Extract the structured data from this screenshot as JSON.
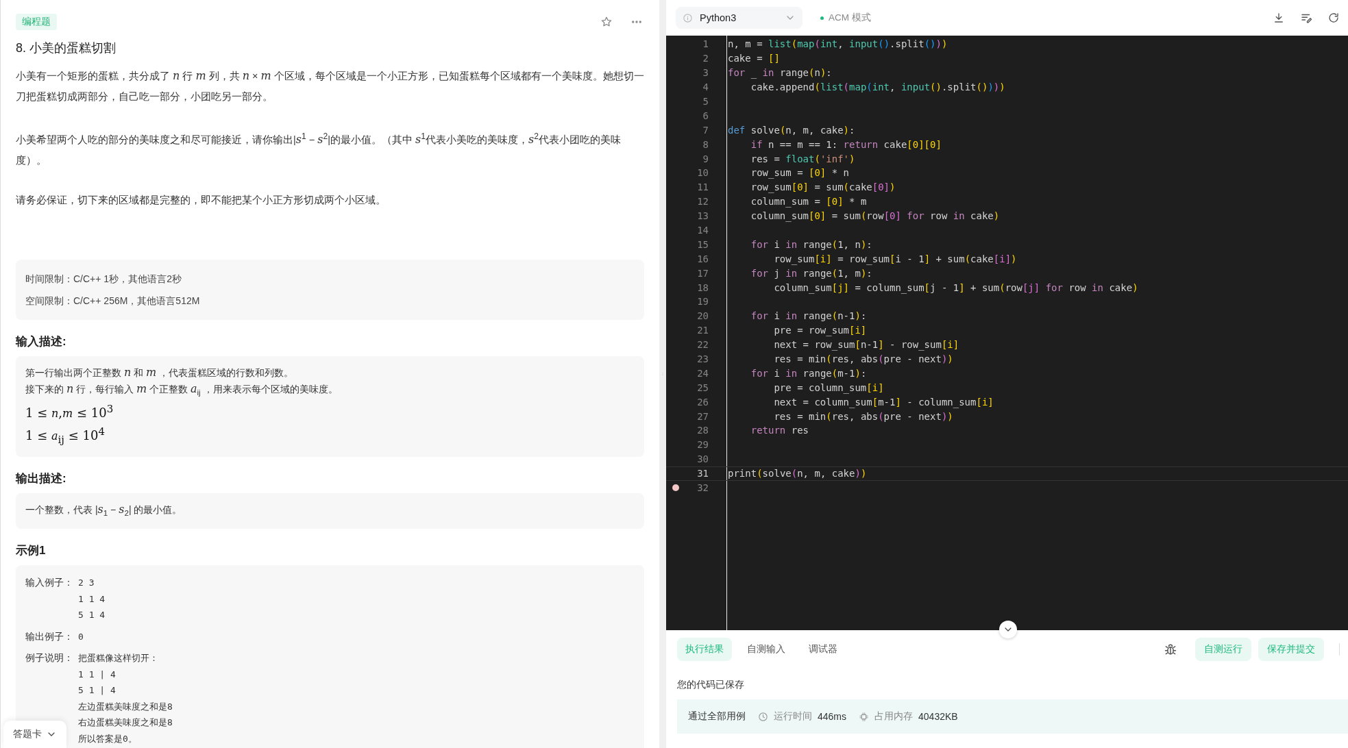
{
  "problem": {
    "tag": "编程题",
    "title": "8. 小美的蛋糕切割",
    "paragraphs": [
      "小美有一个矩形的蛋糕，共分成了 *n* 行 *m* 列，共 *n* × *m* 个区域，每个区域是一个小正方形，已知蛋糕每个区域都有一个美味度。她想切一刀把蛋糕切成两部分，自己吃一部分，小团吃另一部分。",
      "小美希望两个人吃的部分的美味度之和尽可能接近，请你输出|*s*$^{1}$ − *s*$^{2}$|的最小值。（其中 *s*$^{1}$代表小美吃的美味度，*s*$^{2}$代表小团吃的美味度）。",
      "请务必保证，切下来的区域都是完整的，即不能把某个小正方形切成两个小区域。"
    ],
    "limits": [
      "时间限制：C/C++ 1秒，其他语言2秒",
      "空间限制：C/C++ 256M，其他语言512M"
    ],
    "sections": [
      {
        "heading": "输入描述:",
        "lines": [
          {
            "kind": "text",
            "text": "第一行输出两个正整数 *n* 和 *m* ，代表蛋糕区域的行数和列数。"
          },
          {
            "kind": "text",
            "text": "接下来的 *n* 行，每行输入 *m* 个正整数 *a*$_{ij}$ ，用来表示每个区域的美味度。"
          },
          {
            "kind": "formula",
            "text": "1 ≤ *n*,*m* ≤ 10$^{3}$"
          },
          {
            "kind": "formula",
            "text": "1 ≤ *a*$_{ij}$ ≤ 10$^{4}$"
          }
        ]
      },
      {
        "heading": "输出描述:",
        "lines": [
          {
            "kind": "text",
            "text": "一个整数，代表 |*s*$_{1}$ − *s*$_{2}$| 的最小值。"
          }
        ]
      }
    ],
    "example": {
      "heading": "示例1",
      "rows": [
        {
          "label": "输入例子：",
          "lines": [
            "2 3",
            "1 1 4",
            "5 1 4"
          ]
        },
        {
          "label": "输出例子：",
          "lines": [
            "0"
          ]
        },
        {
          "label": "例子说明：",
          "lines": [
            "把蛋糕像这样切开：",
            "1 1 | 4",
            "5 1 | 4",
            "左边蛋糕美味度之和是8",
            "右边蛋糕美味度之和是8",
            "所以答案是0。"
          ]
        }
      ]
    },
    "answer_card": "答题卡"
  },
  "toolbar": {
    "language": "Python3",
    "mode": "ACM 模式"
  },
  "editor": {
    "lines": [
      {
        "n": "1",
        "active": false,
        "breakpoint": false,
        "tokens": [
          {
            "kind": "plain",
            "text": "n, m = "
          },
          {
            "kind": "builtin",
            "text": "list"
          },
          {
            "kind": "bracket1",
            "text": "("
          },
          {
            "kind": "builtin",
            "text": "map"
          },
          {
            "kind": "bracket2",
            "text": "("
          },
          {
            "kind": "builtin",
            "text": "int"
          },
          {
            "kind": "plain",
            "text": ", "
          },
          {
            "kind": "builtin",
            "text": "input"
          },
          {
            "kind": "bracket3",
            "text": "()"
          },
          {
            "kind": "plain",
            "text": ".split"
          },
          {
            "kind": "bracket3",
            "text": "()"
          },
          {
            "kind": "bracket2",
            "text": ")"
          },
          {
            "kind": "bracket1",
            "text": ")"
          }
        ]
      },
      {
        "n": "2",
        "active": false,
        "breakpoint": false,
        "tokens": [
          {
            "kind": "plain",
            "text": "cake = "
          },
          {
            "kind": "bracket1",
            "text": "[]"
          }
        ]
      },
      {
        "n": "3",
        "active": false,
        "breakpoint": false,
        "tokens": [
          {
            "kind": "keyword",
            "text": "for"
          },
          {
            "kind": "plain",
            "text": " _ "
          },
          {
            "kind": "keyword",
            "text": "in"
          },
          {
            "kind": "plain",
            "text": " range"
          },
          {
            "kind": "bracket1",
            "text": "("
          },
          {
            "kind": "plain",
            "text": "n"
          },
          {
            "kind": "bracket1",
            "text": ")"
          },
          {
            "kind": "plain",
            "text": ":"
          }
        ]
      },
      {
        "n": "4",
        "active": false,
        "breakpoint": false,
        "tokens": [
          {
            "kind": "plain",
            "text": "    cake.append"
          },
          {
            "kind": "bracket1",
            "text": "("
          },
          {
            "kind": "builtin",
            "text": "list"
          },
          {
            "kind": "bracket2",
            "text": "("
          },
          {
            "kind": "builtin",
            "text": "map"
          },
          {
            "kind": "bracket3",
            "text": "("
          },
          {
            "kind": "builtin",
            "text": "int"
          },
          {
            "kind": "plain",
            "text": ", "
          },
          {
            "kind": "builtin",
            "text": "input"
          },
          {
            "kind": "bracket1",
            "text": "()"
          },
          {
            "kind": "plain",
            "text": ".split"
          },
          {
            "kind": "bracket1",
            "text": "()"
          },
          {
            "kind": "bracket3",
            "text": ")"
          },
          {
            "kind": "bracket2",
            "text": ")"
          },
          {
            "kind": "bracket1",
            "text": ")"
          }
        ]
      },
      {
        "n": "5",
        "active": false,
        "breakpoint": false
      },
      {
        "n": "6",
        "active": false,
        "breakpoint": false
      },
      {
        "n": "7",
        "active": false,
        "breakpoint": false,
        "tokens": [
          {
            "kind": "def",
            "text": "def"
          },
          {
            "kind": "plain",
            "text": " solve"
          },
          {
            "kind": "bracket1",
            "text": "("
          },
          {
            "kind": "plain",
            "text": "n, m, cake"
          },
          {
            "kind": "bracket1",
            "text": ")"
          },
          {
            "kind": "plain",
            "text": ":"
          }
        ]
      },
      {
        "n": "8",
        "active": false,
        "breakpoint": false,
        "tokens": [
          {
            "kind": "keyword",
            "text": "    if"
          },
          {
            "kind": "plain",
            "text": " n == m == 1: "
          },
          {
            "kind": "keyword",
            "text": "return"
          },
          {
            "kind": "plain",
            "text": " cake"
          },
          {
            "kind": "bracket1",
            "text": "[0][0]"
          }
        ]
      },
      {
        "n": "9",
        "active": false,
        "breakpoint": false,
        "tokens": [
          {
            "kind": "plain",
            "text": "    res = "
          },
          {
            "kind": "builtin",
            "text": "float"
          },
          {
            "kind": "bracket1",
            "text": "("
          },
          {
            "kind": "string",
            "text": "'inf'"
          },
          {
            "kind": "bracket1",
            "text": ")"
          }
        ]
      },
      {
        "n": "10",
        "active": false,
        "breakpoint": false,
        "tokens": [
          {
            "kind": "plain",
            "text": "    row_sum = "
          },
          {
            "kind": "bracket1",
            "text": "[0]"
          },
          {
            "kind": "plain",
            "text": " * n"
          }
        ]
      },
      {
        "n": "11",
        "active": false,
        "breakpoint": false,
        "tokens": [
          {
            "kind": "plain",
            "text": "    row_sum"
          },
          {
            "kind": "bracket1",
            "text": "[0]"
          },
          {
            "kind": "plain",
            "text": " = sum"
          },
          {
            "kind": "bracket1",
            "text": "("
          },
          {
            "kind": "plain",
            "text": "cake"
          },
          {
            "kind": "bracket2",
            "text": "[0]"
          },
          {
            "kind": "bracket1",
            "text": ")"
          }
        ]
      },
      {
        "n": "12",
        "active": false,
        "breakpoint": false,
        "tokens": [
          {
            "kind": "plain",
            "text": "    column_sum = "
          },
          {
            "kind": "bracket1",
            "text": "[0]"
          },
          {
            "kind": "plain",
            "text": " * m"
          }
        ]
      },
      {
        "n": "13",
        "active": false,
        "breakpoint": false,
        "tokens": [
          {
            "kind": "plain",
            "text": "    column_sum"
          },
          {
            "kind": "bracket1",
            "text": "[0]"
          },
          {
            "kind": "plain",
            "text": " = sum"
          },
          {
            "kind": "bracket1",
            "text": "("
          },
          {
            "kind": "plain",
            "text": "row"
          },
          {
            "kind": "bracket2",
            "text": "[0]"
          },
          {
            "kind": "keyword",
            "text": " for"
          },
          {
            "kind": "plain",
            "text": " row "
          },
          {
            "kind": "keyword",
            "text": "in"
          },
          {
            "kind": "plain",
            "text": " cake"
          },
          {
            "kind": "bracket1",
            "text": ")"
          }
        ]
      },
      {
        "n": "14",
        "active": false,
        "breakpoint": false
      },
      {
        "n": "15",
        "active": false,
        "breakpoint": false,
        "tokens": [
          {
            "kind": "keyword",
            "text": "    for"
          },
          {
            "kind": "plain",
            "text": " i "
          },
          {
            "kind": "keyword",
            "text": "in"
          },
          {
            "kind": "plain",
            "text": " range"
          },
          {
            "kind": "bracket1",
            "text": "("
          },
          {
            "kind": "plain",
            "text": "1, n"
          },
          {
            "kind": "bracket1",
            "text": ")"
          },
          {
            "kind": "plain",
            "text": ":"
          }
        ]
      },
      {
        "n": "16",
        "active": false,
        "breakpoint": false,
        "tokens": [
          {
            "kind": "plain",
            "text": "        row_sum"
          },
          {
            "kind": "bracket1",
            "text": "[i]"
          },
          {
            "kind": "plain",
            "text": " = row_sum"
          },
          {
            "kind": "bracket1",
            "text": "["
          },
          {
            "kind": "plain",
            "text": "i - 1"
          },
          {
            "kind": "bracket1",
            "text": "]"
          },
          {
            "kind": "plain",
            "text": " + sum"
          },
          {
            "kind": "bracket1",
            "text": "("
          },
          {
            "kind": "plain",
            "text": "cake"
          },
          {
            "kind": "bracket2",
            "text": "[i]"
          },
          {
            "kind": "bracket1",
            "text": ")"
          }
        ]
      },
      {
        "n": "17",
        "active": false,
        "breakpoint": false,
        "tokens": [
          {
            "kind": "keyword",
            "text": "    for"
          },
          {
            "kind": "plain",
            "text": " j "
          },
          {
            "kind": "keyword",
            "text": "in"
          },
          {
            "kind": "plain",
            "text": " range"
          },
          {
            "kind": "bracket1",
            "text": "("
          },
          {
            "kind": "plain",
            "text": "1, m"
          },
          {
            "kind": "bracket1",
            "text": ")"
          },
          {
            "kind": "plain",
            "text": ":"
          }
        ]
      },
      {
        "n": "18",
        "active": false,
        "breakpoint": false,
        "tokens": [
          {
            "kind": "plain",
            "text": "        column_sum"
          },
          {
            "kind": "bracket1",
            "text": "[j]"
          },
          {
            "kind": "plain",
            "text": " = column_sum"
          },
          {
            "kind": "bracket1",
            "text": "["
          },
          {
            "kind": "plain",
            "text": "j - 1"
          },
          {
            "kind": "bracket1",
            "text": "]"
          },
          {
            "kind": "plain",
            "text": " + sum"
          },
          {
            "kind": "bracket1",
            "text": "("
          },
          {
            "kind": "plain",
            "text": "row"
          },
          {
            "kind": "bracket2",
            "text": "[j]"
          },
          {
            "kind": "keyword",
            "text": " for"
          },
          {
            "kind": "plain",
            "text": " row "
          },
          {
            "kind": "keyword",
            "text": "in"
          },
          {
            "kind": "plain",
            "text": " cake"
          },
          {
            "kind": "bracket1",
            "text": ")"
          }
        ]
      },
      {
        "n": "19",
        "active": false,
        "breakpoint": false
      },
      {
        "n": "20",
        "active": false,
        "breakpoint": false,
        "tokens": [
          {
            "kind": "keyword",
            "text": "    for"
          },
          {
            "kind": "plain",
            "text": " i "
          },
          {
            "kind": "keyword",
            "text": "in"
          },
          {
            "kind": "plain",
            "text": " range"
          },
          {
            "kind": "bracket1",
            "text": "("
          },
          {
            "kind": "plain",
            "text": "n-1"
          },
          {
            "kind": "bracket1",
            "text": ")"
          },
          {
            "kind": "plain",
            "text": ":"
          }
        ]
      },
      {
        "n": "21",
        "active": false,
        "breakpoint": false,
        "tokens": [
          {
            "kind": "plain",
            "text": "        pre = row_sum"
          },
          {
            "kind": "bracket1",
            "text": "[i]"
          }
        ]
      },
      {
        "n": "22",
        "active": false,
        "breakpoint": false,
        "tokens": [
          {
            "kind": "plain",
            "text": "        next = row_sum"
          },
          {
            "kind": "bracket1",
            "text": "["
          },
          {
            "kind": "plain",
            "text": "n-1"
          },
          {
            "kind": "bracket1",
            "text": "]"
          },
          {
            "kind": "plain",
            "text": " - row_sum"
          },
          {
            "kind": "bracket1",
            "text": "[i]"
          }
        ]
      },
      {
        "n": "23",
        "active": false,
        "breakpoint": false,
        "tokens": [
          {
            "kind": "plain",
            "text": "        res = min"
          },
          {
            "kind": "bracket1",
            "text": "("
          },
          {
            "kind": "plain",
            "text": "res, abs"
          },
          {
            "kind": "bracket2",
            "text": "("
          },
          {
            "kind": "plain",
            "text": "pre - next"
          },
          {
            "kind": "bracket2",
            "text": ")"
          },
          {
            "kind": "bracket1",
            "text": ")"
          }
        ]
      },
      {
        "n": "24",
        "active": false,
        "breakpoint": false,
        "tokens": [
          {
            "kind": "keyword",
            "text": "    for"
          },
          {
            "kind": "plain",
            "text": " i "
          },
          {
            "kind": "keyword",
            "text": "in"
          },
          {
            "kind": "plain",
            "text": " range"
          },
          {
            "kind": "bracket1",
            "text": "("
          },
          {
            "kind": "plain",
            "text": "m-1"
          },
          {
            "kind": "bracket1",
            "text": ")"
          },
          {
            "kind": "plain",
            "text": ":"
          }
        ]
      },
      {
        "n": "25",
        "active": false,
        "breakpoint": false,
        "tokens": [
          {
            "kind": "plain",
            "text": "        pre = column_sum"
          },
          {
            "kind": "bracket1",
            "text": "[i]"
          }
        ]
      },
      {
        "n": "26",
        "active": false,
        "breakpoint": false,
        "tokens": [
          {
            "kind": "plain",
            "text": "        next = column_sum"
          },
          {
            "kind": "bracket1",
            "text": "["
          },
          {
            "kind": "plain",
            "text": "m-1"
          },
          {
            "kind": "bracket1",
            "text": "]"
          },
          {
            "kind": "plain",
            "text": " - column_sum"
          },
          {
            "kind": "bracket1",
            "text": "[i]"
          }
        ]
      },
      {
        "n": "27",
        "active": false,
        "breakpoint": false,
        "tokens": [
          {
            "kind": "plain",
            "text": "        res = min"
          },
          {
            "kind": "bracket1",
            "text": "("
          },
          {
            "kind": "plain",
            "text": "res, abs"
          },
          {
            "kind": "bracket2",
            "text": "("
          },
          {
            "kind": "plain",
            "text": "pre - next"
          },
          {
            "kind": "bracket2",
            "text": ")"
          },
          {
            "kind": "bracket1",
            "text": ")"
          }
        ]
      },
      {
        "n": "28",
        "active": false,
        "breakpoint": false,
        "tokens": [
          {
            "kind": "keyword",
            "text": "    return"
          },
          {
            "kind": "plain",
            "text": " res"
          }
        ]
      },
      {
        "n": "29",
        "active": false,
        "breakpoint": false
      },
      {
        "n": "30",
        "active": false,
        "breakpoint": false
      },
      {
        "n": "31",
        "active": true,
        "breakpoint": false,
        "tokens": [
          {
            "kind": "plain",
            "text": "print"
          },
          {
            "kind": "bracket1",
            "text": "("
          },
          {
            "kind": "plain",
            "text": "solve"
          },
          {
            "kind": "bracket2",
            "text": "("
          },
          {
            "kind": "plain",
            "text": "n, m, cake"
          },
          {
            "kind": "bracket2",
            "text": ")"
          },
          {
            "kind": "bracket1",
            "text": ")"
          }
        ]
      },
      {
        "n": "32",
        "active": false,
        "breakpoint": true
      }
    ]
  },
  "console": {
    "tabs": [
      {
        "label": "执行结果",
        "selected": true
      },
      {
        "label": "自测输入",
        "selected": false
      },
      {
        "label": "调试器",
        "selected": false
      }
    ],
    "buttons": [
      "自测运行",
      "保存并提交"
    ],
    "status": "您的代码已保存",
    "result": {
      "verdict": "通过全部用例",
      "time_label": "运行时间",
      "time": "446ms",
      "memory_label": "占用内存",
      "memory": "40432KB"
    }
  }
}
